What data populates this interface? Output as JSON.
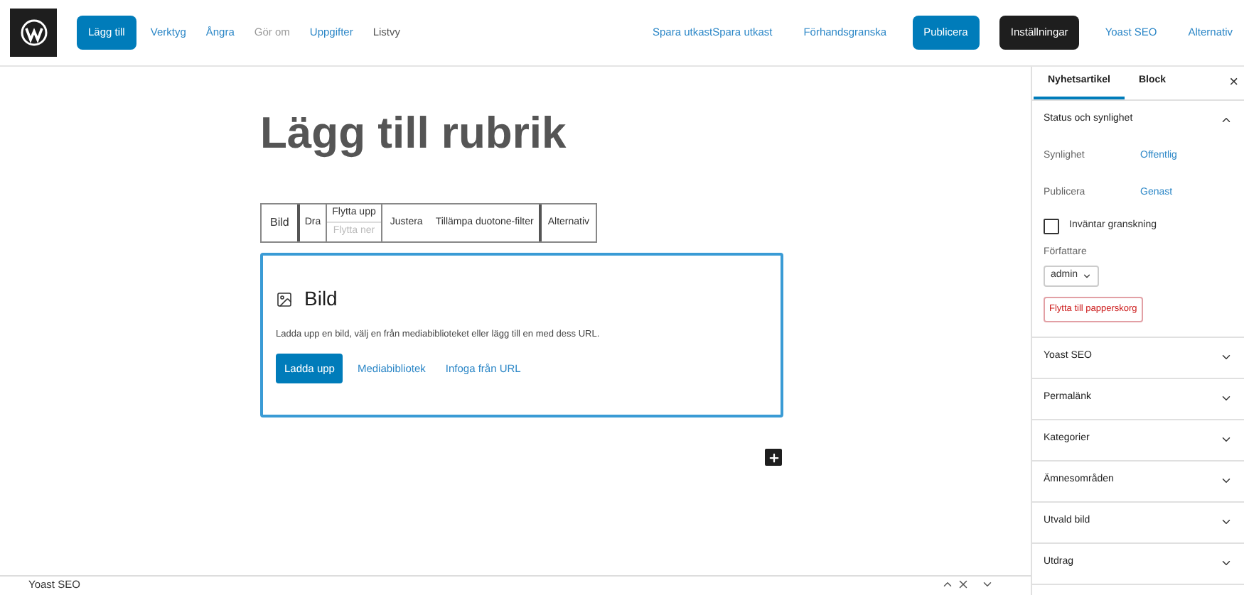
{
  "toolbar": {
    "left": [
      {
        "label": "Lägg till",
        "kind": "primary"
      },
      {
        "label": "Verktyg",
        "kind": "link"
      },
      {
        "label": "Ångra",
        "kind": "link"
      },
      {
        "label": "Gör om",
        "kind": "muted"
      },
      {
        "label": "Uppgifter",
        "kind": "link"
      },
      {
        "label": "Listvy",
        "kind": "plain"
      }
    ],
    "right": [
      {
        "label": "Spara utkastSpara utkast",
        "kind": "link"
      },
      {
        "label": "Förhandsgranska",
        "kind": "link"
      },
      {
        "label": "Publicera",
        "kind": "primary"
      },
      {
        "label": "Inställningar",
        "kind": "dark"
      },
      {
        "label": "Yoast SEO",
        "kind": "link"
      },
      {
        "label": "Alternativ",
        "kind": "link"
      }
    ]
  },
  "editor": {
    "title_placeholder": "Lägg till rubrik",
    "block_toolbar": {
      "type": "Bild",
      "drag": "Dra",
      "move_up": "Flytta upp",
      "move_down": "Flytta ner",
      "move_down_disabled": true,
      "align": "Justera",
      "duotone": "Tillämpa duotone-filter",
      "options": "Alternativ"
    },
    "image_block": {
      "title": "Bild",
      "description": "Ladda upp en bild, välj en från mediabiblioteket eller lägg till en med dess URL.",
      "upload": "Ladda upp",
      "library": "Mediabibliotek",
      "insert_url": "Infoga från URL"
    }
  },
  "sidebar": {
    "tabs": [
      {
        "label": "Nyhetsartikel",
        "selected": true
      },
      {
        "label": "Block",
        "selected": false
      }
    ],
    "close": "×",
    "status": {
      "title": "Status och synlighet",
      "expanded": true,
      "rows": [
        {
          "label": "Synlighet",
          "value": "Offentlig"
        },
        {
          "label": "Publicera",
          "value": "Genast"
        }
      ],
      "pending": {
        "label": "Inväntar granskning",
        "checked": false
      },
      "author_label": "Författare",
      "author": "admin",
      "trash": "Flytta till papperskorg"
    },
    "panels": [
      {
        "title": "Yoast SEO",
        "expanded": false
      },
      {
        "title": "Permalänk",
        "expanded": false
      },
      {
        "title": "Kategorier",
        "expanded": false
      },
      {
        "title": "Ämnesområden",
        "expanded": false
      },
      {
        "title": "Utvald bild",
        "expanded": false
      },
      {
        "title": "Utdrag",
        "expanded": false
      }
    ]
  },
  "bottom_panel": {
    "title": "Yoast SEO"
  }
}
